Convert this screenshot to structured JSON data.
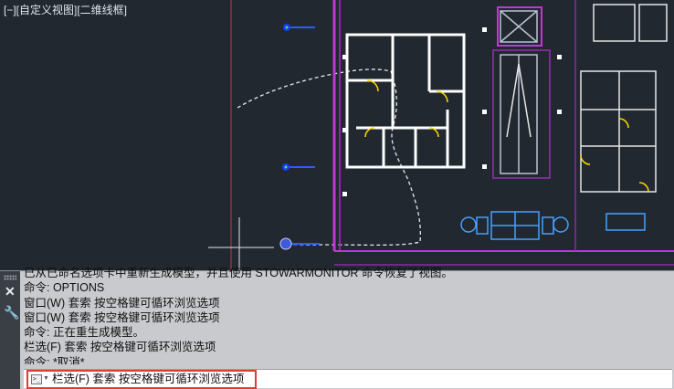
{
  "viewport": {
    "label": "[−][自定义视图][二维线框]"
  },
  "command_history": [
    "已从已命名选项卡中重新生成模型，并且使用 STOWARMONITOR 命令恢复了视图。",
    "命令:  OPTIONS",
    "窗口(W) 套索  按空格键可循环浏览选项",
    "窗口(W) 套索  按空格键可循环浏览选项",
    "命令:  正在重生成模型。",
    "栏选(F) 套索  按空格键可循环浏览选项",
    "命令: *取消*"
  ],
  "command_input": {
    "prompt": "栏选(F) 套索  按空格键可循环浏览选项",
    "icon": "command-prompt-icon"
  },
  "side_panel": {
    "close_icon": "✕",
    "settings_icon": "wrench-icon"
  },
  "colors": {
    "canvas": "#212830",
    "wall": "#ffffff",
    "highlight": "#c235d6",
    "door": "#ffd800",
    "furniture": "#46a0ff",
    "origin_line": "#c43a3a",
    "panel": "#c8cacd",
    "input_border": "#e23b31"
  }
}
